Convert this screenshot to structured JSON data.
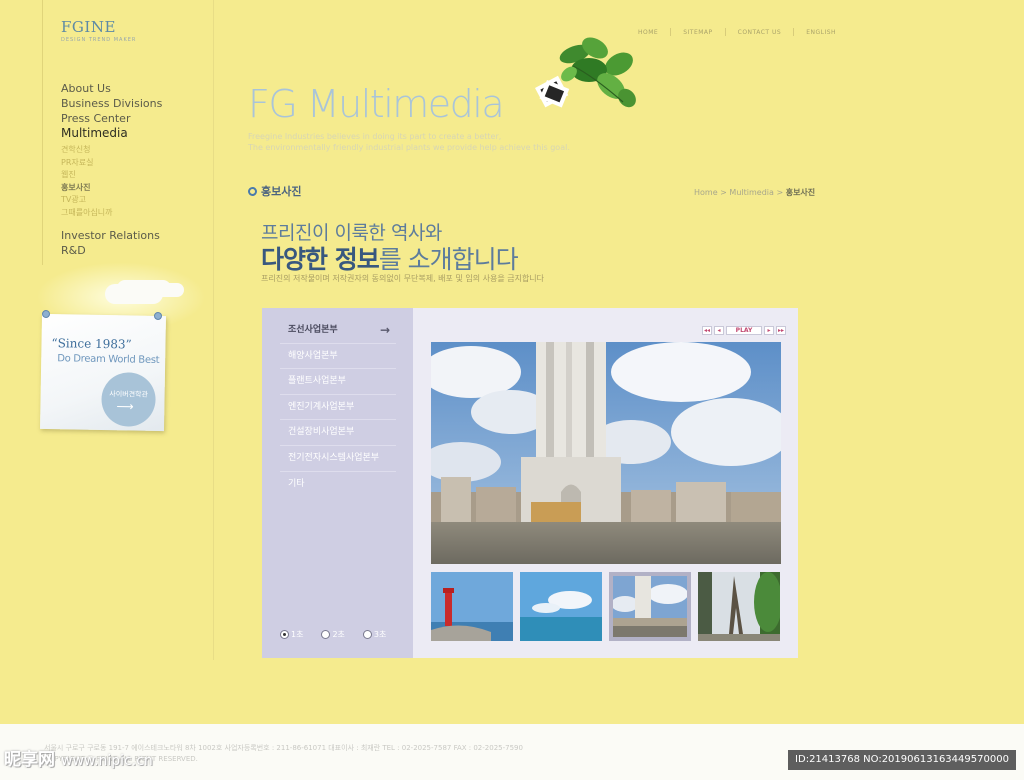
{
  "logo": {
    "title": "FGINE",
    "subtitle": "DESIGN TREND MAKER"
  },
  "top_links": [
    "HOME",
    "SITEMAP",
    "CONTACT US",
    "ENGLISH"
  ],
  "nav": {
    "primary_top": [
      {
        "label": "About Us"
      },
      {
        "label": "Business Divisions"
      },
      {
        "label": "Press Center"
      },
      {
        "label": "Multimedia",
        "active": true
      }
    ],
    "sub": [
      {
        "label": "견학신청"
      },
      {
        "label": "PR자료실"
      },
      {
        "label": "웹진"
      },
      {
        "label": "홍보사진",
        "active": true
      },
      {
        "label": "TV광고"
      },
      {
        "label": "그때를아십니까"
      }
    ],
    "primary_bottom": [
      {
        "label": "Investor Relations"
      },
      {
        "label": "R&D"
      }
    ]
  },
  "note": {
    "since": "“Since 1983”",
    "tagline": "Do Dream World Best",
    "button_label": "사이버견학관",
    "button_icon": "arrow-right-icon"
  },
  "brand": {
    "title": "FG Multimedia",
    "desc_line1": "Freegine Industries believes in doing its part to create a better,",
    "desc_line2": "The environmentally friendly industrial plants we provide help achieve this goal."
  },
  "section": {
    "title": "홍보사진",
    "breadcrumb": [
      "Home",
      "Multimedia",
      "홍보사진"
    ]
  },
  "headline": {
    "line1": "프리진이 이룩한 역사와",
    "line2_strong": "다양한 정보",
    "line2_rest": "를 소개합니다",
    "notice": "프리진의 저작물이며 저작권자의 동의없이 무단복제, 배포 및 임의 사용을 금지합니다"
  },
  "gallery": {
    "menu": [
      {
        "label": "조선사업본부",
        "active": true
      },
      {
        "label": "해양사업본부"
      },
      {
        "label": "플랜트사업본부"
      },
      {
        "label": "엔진기계사업본부"
      },
      {
        "label": "건설장비사업본부"
      },
      {
        "label": "전기전자시스템사업본부"
      },
      {
        "label": "기타"
      }
    ],
    "controls": [
      "◂◂",
      "◂",
      "PLAY",
      "▸",
      "▸▸"
    ],
    "timer_options": [
      {
        "label": "1초",
        "checked": true
      },
      {
        "label": "2초",
        "checked": false
      },
      {
        "label": "3초",
        "checked": false
      }
    ],
    "main_photo": "city-skyscraper-riverside",
    "thumbnails": [
      {
        "name": "red-lighthouse",
        "selected": false
      },
      {
        "name": "calm-sea-sky",
        "selected": false
      },
      {
        "name": "city-skyscraper-riverside",
        "selected": true
      },
      {
        "name": "eiffel-tower",
        "selected": false
      }
    ]
  },
  "footer": {
    "line1": "서울시 구로구 구로동 191-7 에이스테크노타워 8차 1002호   사업자등록번호 : 211-86-61071   대표이사 : 최재란     TEL : 02-2025-7587    FAX : 02-2025-7590",
    "line2": "COPYRIGHT ⓒ FGINE ALL RIGHT RESERVED."
  },
  "watermark": {
    "left": "昵享网",
    "left_url": "www.nipic.cn",
    "right": "ID:21413768 NO:20190613163449570000"
  },
  "colors": {
    "background": "#f5eb8e",
    "brand_blue": "#a9c4d9",
    "headline_blue": "#38587f",
    "menu_panel": "#cfcee3",
    "play_text": "#c24a72"
  }
}
